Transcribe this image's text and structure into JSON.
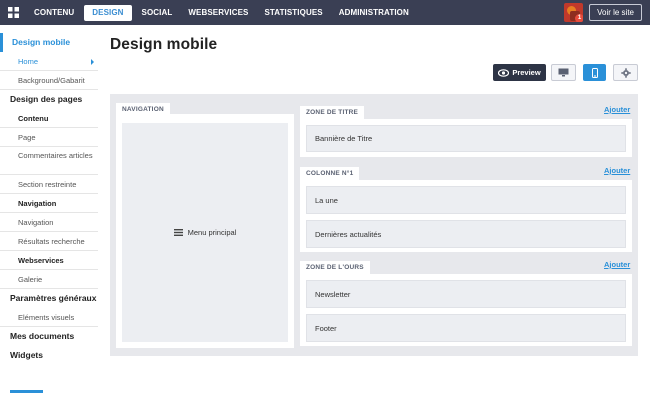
{
  "topbar": {
    "nav": [
      "CONTENU",
      "DESIGN",
      "SOCIAL",
      "WEBSERVICES",
      "STATISTIQUES",
      "ADMINISTRATION"
    ],
    "active": "DESIGN",
    "voir_site": "Voir le site",
    "notification_count": "1"
  },
  "sidebar": {
    "design_mobile": "Design mobile",
    "home": "Home",
    "background": "Background/Gabarit",
    "design_pages": "Design des pages",
    "contenu": "Contenu",
    "page": "Page",
    "commentaires": "Commentaires articles",
    "section": "Section restreinte",
    "navigation_head": "Navigation",
    "navigation": "Navigation",
    "resultats": "Résultats recherche",
    "webservices": "Webservices",
    "galerie": "Galerie",
    "parametres": "Paramètres généraux",
    "elements": "Eléments visuels",
    "documents": "Mes documents",
    "widgets": "Widgets"
  },
  "main": {
    "title": "Design mobile",
    "preview_label": "Preview",
    "navigation_label": "NAVIGATION",
    "menu_principal": "Menu principal",
    "zones": [
      {
        "label": "ZONE DE TITRE",
        "ajouter": "Ajouter",
        "blocks": [
          "Bannière de Titre"
        ]
      },
      {
        "label": "COLONNE N°1",
        "ajouter": "Ajouter",
        "blocks": [
          "La une",
          "Dernières actualités"
        ]
      },
      {
        "label": "ZONE DE L'OURS",
        "ajouter": "Ajouter",
        "blocks": [
          "Newsletter",
          "Footer"
        ]
      }
    ]
  },
  "colors": {
    "topbar": "#3a3f54",
    "accent": "#2a90d8",
    "canvas": "#e7e8ec"
  }
}
